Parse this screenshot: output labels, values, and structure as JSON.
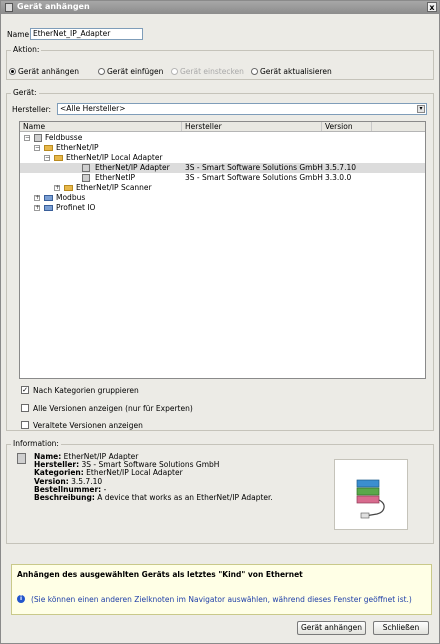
{
  "window": {
    "title": "Gerät anhängen",
    "close_label": "x"
  },
  "name": {
    "label": "Name:",
    "value": "EtherNet_IP_Adapter"
  },
  "action": {
    "legend": "Aktion:",
    "options": [
      {
        "label": "Gerät anhängen",
        "selected": true,
        "disabled": false
      },
      {
        "label": "Gerät einfügen",
        "selected": false,
        "disabled": false
      },
      {
        "label": "Gerät einstecken",
        "selected": false,
        "disabled": true
      },
      {
        "label": "Gerät aktualisieren",
        "selected": false,
        "disabled": false
      }
    ]
  },
  "device": {
    "legend": "Gerät:",
    "vendor_label": "Hersteller:",
    "vendor_value": "<Alle Hersteller>",
    "columns": [
      "Name",
      "Hersteller",
      "Version"
    ],
    "tree": [
      {
        "name": "Feldbusse",
        "vendor": "",
        "version": "",
        "expander": "−"
      },
      {
        "name": "EtherNet/IP",
        "vendor": "",
        "version": "",
        "expander": "−"
      },
      {
        "name": "EtherNet/IP Local Adapter",
        "vendor": "",
        "version": "",
        "expander": "−"
      },
      {
        "name": "EtherNet/IP Adapter",
        "vendor": "3S - Smart Software Solutions GmbH",
        "version": "3.5.7.10",
        "expander": ""
      },
      {
        "name": "EtherNetIP",
        "vendor": "3S - Smart Software Solutions GmbH",
        "version": "3.3.0.0",
        "expander": ""
      },
      {
        "name": "EtherNet/IP Scanner",
        "vendor": "",
        "version": "",
        "expander": "+"
      },
      {
        "name": "Modbus",
        "vendor": "",
        "version": "",
        "expander": "+"
      },
      {
        "name": "Profinet IO",
        "vendor": "",
        "version": "",
        "expander": "+"
      }
    ]
  },
  "options": {
    "group_by_category": {
      "label": "Nach Kategorien gruppieren",
      "checked": true
    },
    "all_versions": {
      "label": "Alle Versionen anzeigen (nur für Experten)",
      "checked": false
    },
    "outdated_versions": {
      "label": "Veraltete Versionen anzeigen",
      "checked": false
    }
  },
  "information": {
    "legend": "Information:",
    "fields": [
      {
        "key": "Name:",
        "value": "EtherNet/IP Adapter"
      },
      {
        "key": "Hersteller:",
        "value": "3S - Smart Software Solutions GmbH"
      },
      {
        "key": "Kategorien:",
        "value": "EtherNet/IP Local Adapter"
      },
      {
        "key": "Version:",
        "value": "3.5.7.10"
      },
      {
        "key": "Bestellnummer:",
        "value": "-"
      },
      {
        "key": "Beschreibung:",
        "value": "A device that works as an EtherNet/IP Adapter."
      }
    ]
  },
  "hint": {
    "title": "Anhängen des ausgewählten Geräts als letztes \"Kind\" von Ethernet",
    "note": "(Sie können einen anderen Zielknoten im Navigator auswählen, während dieses Fenster geöffnet ist.)"
  },
  "buttons": {
    "attach": "Gerät anhängen",
    "close": "Schließen"
  },
  "colors": {
    "info_icon": "#2255cc",
    "selected_row": "#dcdcdc"
  }
}
